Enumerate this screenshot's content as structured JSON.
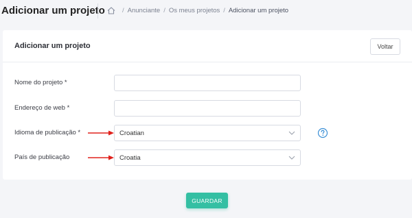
{
  "header": {
    "title": "Adicionar um projeto",
    "breadcrumb": {
      "home_icon": "home-icon",
      "separator": "/",
      "items": [
        "Anunciante",
        "Os meus projetos",
        "Adicionar um projeto"
      ]
    }
  },
  "card": {
    "title": "Adicionar um projeto",
    "back_label": "Voltar"
  },
  "form": {
    "project_name": {
      "label": "Nome do projeto *",
      "value": ""
    },
    "web_address": {
      "label": "Endereço de web *",
      "value": ""
    },
    "publication_language": {
      "label": "Idioma de publicação *",
      "selected": "Croatian",
      "help_icon": "question-circle-icon"
    },
    "publication_country": {
      "label": "País de publicação",
      "selected": "Croatia"
    }
  },
  "footer": {
    "save_label": "GUARDAR"
  },
  "colors": {
    "accent": "#34bfa3",
    "annotation_arrow": "#e0201b",
    "help_icon": "#3a8fd6",
    "background": "#f4f5f8"
  }
}
